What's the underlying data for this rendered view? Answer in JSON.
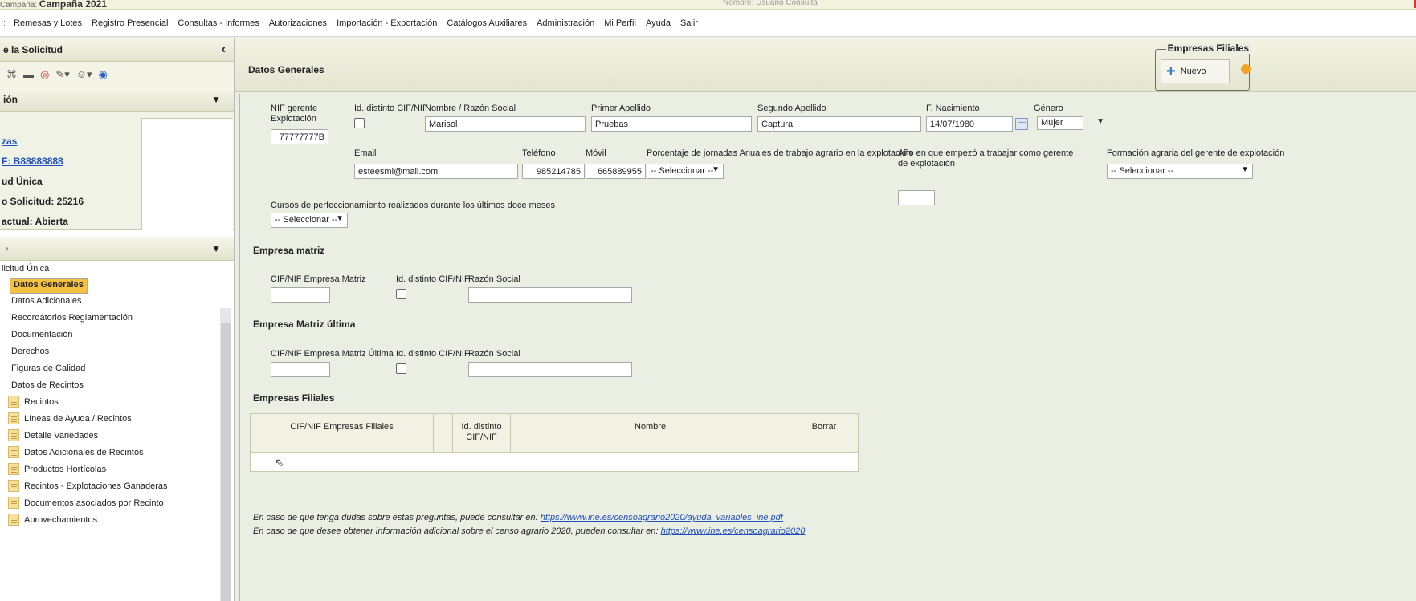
{
  "topbar": {
    "campaign_prefix": "Campaña:",
    "campaign": "Campaña 2021",
    "user_info": "Nombre: Usuario Consulta"
  },
  "menu": {
    "first_sep": ":",
    "items": [
      "Remesas y Lotes",
      "Registro Presencial",
      "Consultas - Informes",
      "Autorizaciones",
      "Importación - Exportación",
      "Catálogos Auxiliares",
      "Administración",
      "Mi Perfil",
      "Ayuda",
      "Salir"
    ]
  },
  "left": {
    "solicitud_header": "e la Solicitud",
    "collapse_icon": "‹",
    "section2_header": "ión",
    "info": {
      "line1": "zas",
      "line2": "F: B88888888",
      "line3": "ud Única",
      "line4": "o Solicitud: 25216",
      "line5": "actual: Abierta"
    },
    "tree": {
      "root": "licitud Única",
      "items": [
        "Datos Generales",
        "Datos Adicionales",
        "Recordatorios Reglamentación",
        "Documentación",
        "Derechos",
        "Figuras de Calidad",
        "Datos de Recintos"
      ],
      "doc_items": [
        "Recintos",
        "Líneas de Ayuda / Recintos",
        "Detalle Variedades",
        "Datos Adicionales de Recintos",
        "Productos Hortícolas",
        "Recintos - Explotaciones Ganaderas",
        "Documentos asociados por Recinto",
        "Aprovechamientos"
      ]
    }
  },
  "main": {
    "title": "Datos Generales",
    "filiales_box": {
      "legend": "Empresas Filiales",
      "new_label": "Nuevo"
    },
    "gerente": {
      "nif_label": "NIF gerente Explotación",
      "nif_value": "77777777B",
      "id_label": "Id. distinto CIF/NIF",
      "nombre_label": "Nombre / Razón Social",
      "nombre_value": "Marisol",
      "primer_label": "Primer Apellido",
      "primer_value": "Pruebas",
      "segundo_label": "Segundo Apellido",
      "segundo_value": "Captura",
      "fnac_label": "F. Nacimiento",
      "fnac_value": "14/07/1980",
      "genero_label": "Género",
      "genero_value": "Mujer",
      "email_label": "Email",
      "email_value": "esteesmi@mail.com",
      "tel_label": "Teléfono",
      "tel_value": "985214785",
      "movil_label": "Móvil",
      "movil_value": "665889955",
      "porcentaje_label": "Porcentaje de jornadas Anuales de trabajo agrario en la explotación",
      "porcentaje_value": "-- Seleccionar --",
      "anio_label": "Año en que empezó a trabajar como gerente de explotación",
      "formacion_label": "Formación agraria del gerente de explotación",
      "formacion_value": "-- Seleccionar --",
      "cursos_label": "Cursos de perfeccionamiento realizados durante los últimos doce meses",
      "cursos_value": "-- Seleccionar --"
    },
    "matriz": {
      "title": "Empresa matriz",
      "cif_label": "CIF/NIF Empresa Matriz",
      "id_label": "Id. distinto CIF/NIF",
      "razon_label": "Razón Social"
    },
    "matriz_ultima": {
      "title": "Empresa Matriz última",
      "cif_label": "CIF/NIF Empresa Matriz Última",
      "id_label": "Id. distinto CIF/NIF",
      "razon_label": "Razón Social"
    },
    "filiales": {
      "title": "Empresas Filiales",
      "columns": [
        "CIF/NIF Empresas Filiales",
        "",
        "Id. distinto CIF/NIF",
        "Nombre",
        "Borrar"
      ]
    },
    "notes": {
      "line1_text": "En caso de que tenga dudas sobre estas preguntas, puede consultar en:",
      "line1_link": "https://www.ine.es/censoagrario2020/ayuda_variables_ine.pdf",
      "line2_text": "En caso de que desee obtener información adicional sobre el censo agrario 2020, pueden consultar en:",
      "line2_link": "https://www.ine.es/censoagrario2020"
    }
  }
}
